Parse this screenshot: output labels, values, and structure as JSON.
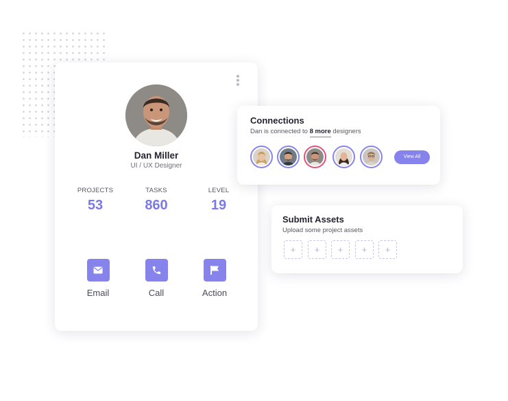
{
  "profile": {
    "name": "Dan Miller",
    "role": "UI / UX Designer",
    "stats": [
      {
        "label": "PROJECTS",
        "value": "53"
      },
      {
        "label": "TASKS",
        "value": "860"
      },
      {
        "label": "LEVEL",
        "value": "19"
      }
    ],
    "actions": [
      {
        "label": "Email",
        "icon": "envelope-icon"
      },
      {
        "label": "Call",
        "icon": "phone-icon"
      },
      {
        "label": "Action",
        "icon": "flag-icon"
      }
    ]
  },
  "connections": {
    "title": "Connections",
    "subtitle_prefix": "Dan is connected to",
    "more_link": "8 more",
    "subtitle_suffix": "designers",
    "view_all_label": "View All"
  },
  "assets": {
    "title": "Submit Assets",
    "subtitle": "Upload some project assets",
    "slot_symbol": "+"
  },
  "colors": {
    "accent": "#8683ec",
    "stat_value": "#7b78e8",
    "highlight_ring": "#e0517d"
  }
}
